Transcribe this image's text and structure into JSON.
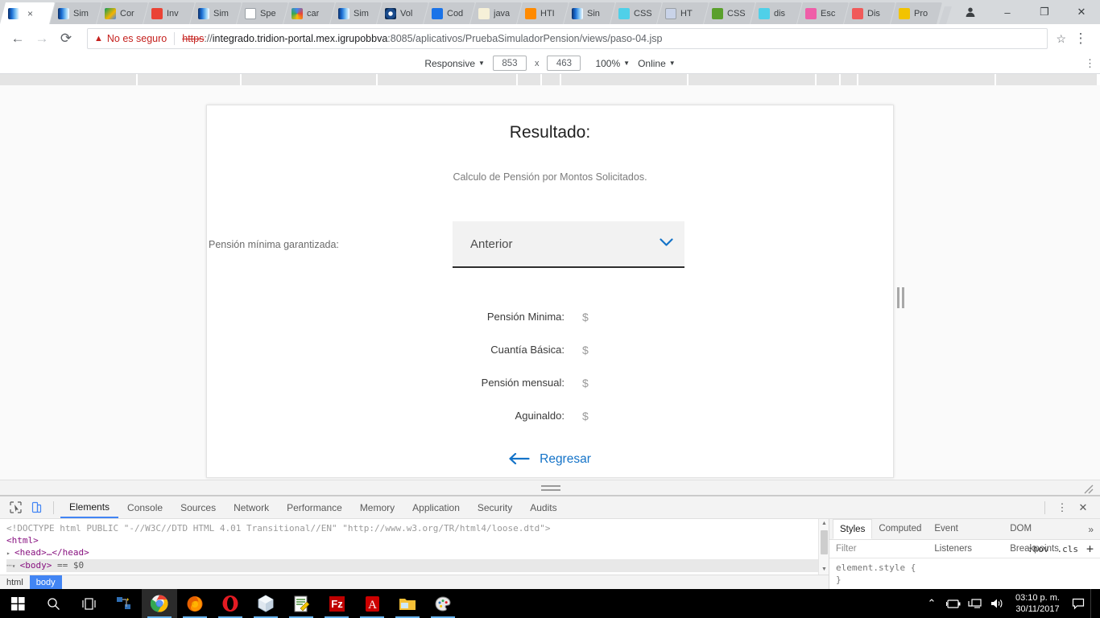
{
  "browser": {
    "tabs": [
      {
        "label": "",
        "favicon": "blue-gradient-icon",
        "active": true,
        "close": "×"
      },
      {
        "label": "Sim",
        "favicon": "blue-gradient-icon",
        "active": false
      },
      {
        "label": "Cor",
        "favicon": "google-drive-icon",
        "active": false
      },
      {
        "label": "Inv",
        "favicon": "gmail-icon",
        "active": false
      },
      {
        "label": "Sim",
        "favicon": "blue-gradient-icon",
        "active": false
      },
      {
        "label": "Spe",
        "favicon": "document-icon",
        "active": false
      },
      {
        "label": "car",
        "favicon": "google-icon",
        "active": false
      },
      {
        "label": "Sim",
        "favicon": "blue-gradient-icon",
        "active": false
      },
      {
        "label": "Vol",
        "favicon": "target-icon",
        "active": false
      },
      {
        "label": "Cod",
        "favicon": "play-blue-icon",
        "active": false
      },
      {
        "label": "java",
        "favicon": "text-file-icon",
        "active": false
      },
      {
        "label": "HTI",
        "favicon": "asterisk-orange-icon",
        "active": false
      },
      {
        "label": "Sin",
        "favicon": "blue-gradient-icon",
        "active": false
      },
      {
        "label": "CSS",
        "favicon": "cyan-shape-icon",
        "active": false
      },
      {
        "label": "HT",
        "favicon": "braces-icon",
        "active": false
      },
      {
        "label": "CSS",
        "favicon": "green-pill-icon",
        "active": false
      },
      {
        "label": "dis",
        "favicon": "cyan-shape-icon",
        "active": false
      },
      {
        "label": "Esc",
        "favicon": "e-pink-icon",
        "active": false
      },
      {
        "label": "Dis",
        "favicon": "u-red-icon",
        "active": false
      },
      {
        "label": "Pro",
        "favicon": "yellow-note-icon",
        "active": false
      }
    ],
    "window_controls": {
      "profile": "account-icon",
      "minimize": "–",
      "maximize": "❐",
      "close": "✕"
    },
    "nav": {
      "back": "←",
      "forward": "→",
      "reload": "⟳",
      "bookmark_star": "☆"
    },
    "omnibox": {
      "security_label": "No es seguro",
      "security_icon": "warning-triangle-icon",
      "url_scheme": "https",
      "url_scheme_separator": "://",
      "url_host": "integrado.tridion-portal.mex.igrupobbva",
      "url_rest": ":8085/aplicativos/PruebaSimuladorPension/views/paso-04.jsp"
    },
    "menu_icon": "vertical-dots-icon"
  },
  "device_toolbar": {
    "device_label": "Responsive",
    "width": "853",
    "height": "463",
    "dimension_separator": "x",
    "zoom": "100%",
    "throttling": "Online",
    "caret": "▼",
    "more_icon": "vertical-dots-icon"
  },
  "page": {
    "title": "Resultado:",
    "subtitle": "Calculo de Pensión por Montos Solicitados.",
    "select_label": "Pensión mínima garantizada:",
    "select_value": "Anterior",
    "select_caret": "⌄",
    "rows": [
      {
        "label": "Pensión Minima:",
        "value": "$"
      },
      {
        "label": "Cuantía Básica:",
        "value": "$"
      },
      {
        "label": "Pensión mensual:",
        "value": "$"
      },
      {
        "label": "Aguinaldo:",
        "value": "$"
      }
    ],
    "back_link": "Regresar",
    "back_arrow": "←",
    "accent_color": "#1473c8"
  },
  "devtools": {
    "inspect_icon": "inspect-cursor-icon",
    "device_toggle_icon": "device-toolbar-icon",
    "tabs": [
      {
        "label": "Elements",
        "active": true
      },
      {
        "label": "Console",
        "active": false
      },
      {
        "label": "Sources",
        "active": false
      },
      {
        "label": "Network",
        "active": false
      },
      {
        "label": "Performance",
        "active": false
      },
      {
        "label": "Memory",
        "active": false
      },
      {
        "label": "Application",
        "active": false
      },
      {
        "label": "Security",
        "active": false
      },
      {
        "label": "Audits",
        "active": false
      }
    ],
    "more_icon": "vertical-dots-icon",
    "close_icon": "close-icon",
    "dom": {
      "doctype": "<!DOCTYPE html PUBLIC \"-//W3C//DTD HTML 4.01 Transitional//EN\" \"http://www.w3.org/TR/html4/loose.dtd\">",
      "line_html": "<html>",
      "line_head": "<head>…</head>",
      "line_body": "<body>",
      "selected_marker": "== $0"
    },
    "breadcrumb": [
      {
        "label": "html",
        "active": false
      },
      {
        "label": "body",
        "active": true
      }
    ],
    "styles": {
      "tabs": [
        {
          "label": "Styles",
          "active": true
        },
        {
          "label": "Computed",
          "active": false
        },
        {
          "label": "Event Listeners",
          "active": false
        },
        {
          "label": "DOM Breakpoints",
          "active": false
        }
      ],
      "overflow": "»",
      "filter_placeholder": "Filter",
      "hov": ":hov",
      "cls": ".cls",
      "add": "+",
      "rule_selector": "element.style {",
      "rule_close": "}"
    }
  },
  "taskbar": {
    "items": [
      {
        "name": "start-button",
        "icon": "windows-logo-icon"
      },
      {
        "name": "search-button",
        "icon": "search-icon"
      },
      {
        "name": "task-view-button",
        "icon": "task-view-icon"
      },
      {
        "name": "network-share-icon",
        "icon": "network-icon"
      },
      {
        "name": "chrome-taskbar-item",
        "icon": "chrome-icon"
      },
      {
        "name": "firefox-taskbar-item",
        "icon": "firefox-icon"
      },
      {
        "name": "opera-taskbar-item",
        "icon": "opera-icon"
      },
      {
        "name": "virtualbox-taskbar-item",
        "icon": "cube-icon"
      },
      {
        "name": "notepad-taskbar-item",
        "icon": "notepad-icon"
      },
      {
        "name": "filezilla-taskbar-item",
        "icon": "filezilla-icon"
      },
      {
        "name": "acrobat-taskbar-item",
        "icon": "pdf-icon"
      },
      {
        "name": "explorer-taskbar-item",
        "icon": "folder-icon"
      },
      {
        "name": "paint-taskbar-item",
        "icon": "paint-icon"
      }
    ],
    "tray": {
      "chevron": "⌃",
      "battery_icon": "battery-icon",
      "network_icon": "network-monitor-icon",
      "volume_icon": "volume-icon",
      "time": "03:10 p. m.",
      "date": "30/11/2017",
      "notifications_icon": "notification-icon"
    }
  }
}
